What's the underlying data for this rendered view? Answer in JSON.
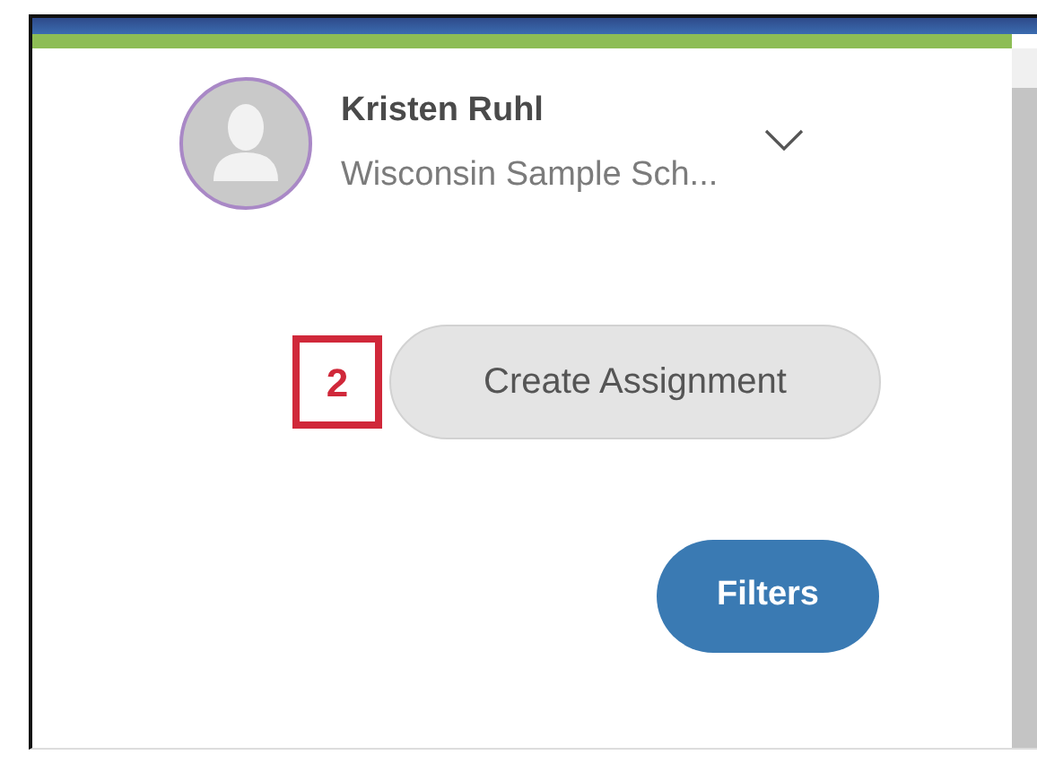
{
  "profile": {
    "name": "Kristen Ruhl",
    "school": "Wisconsin Sample Sch...",
    "expanded": false
  },
  "callout": {
    "number": "2"
  },
  "buttons": [
    {
      "label": "Create Assignment",
      "kind": "secondary"
    },
    {
      "label": "Filters",
      "kind": "primary"
    }
  ]
}
